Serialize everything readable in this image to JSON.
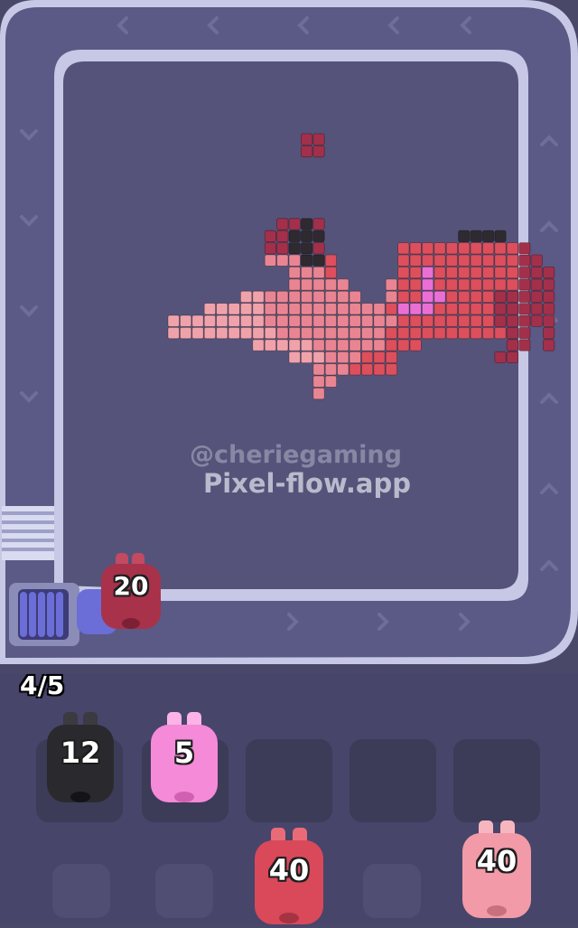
{
  "game": {
    "watermark_handle": "@cheriegaming",
    "watermark_site": "Pixel-flow.app",
    "queue_counter": "4/5",
    "conveyor_pig": {
      "count": "20",
      "color": "#a8324a"
    },
    "slots": [
      {
        "count": "12",
        "color": "#2a2a2e",
        "filled": true
      },
      {
        "count": "5",
        "color": "#f58ad8",
        "filled": true
      },
      {
        "filled": false
      },
      {
        "filled": false
      },
      {
        "filled": false
      }
    ],
    "waiting_pigs": [
      {
        "count": "40",
        "color": "#d9495a"
      },
      {
        "count": "40",
        "color": "#f29aa7"
      }
    ]
  },
  "palette": {
    "background": "#4a4869",
    "board": "#55537a",
    "belt": "#5b5985",
    "belt_rail": "#c7c8e6",
    "slot": "#3c3b58",
    "pixel_dark": "#2e2a30",
    "pixel_maroon": "#a3304a",
    "pixel_red": "#dd4f5c",
    "pixel_rose": "#e98592",
    "pixel_pink": "#f0a2ab",
    "pixel_magenta": "#ea6fd5"
  }
}
